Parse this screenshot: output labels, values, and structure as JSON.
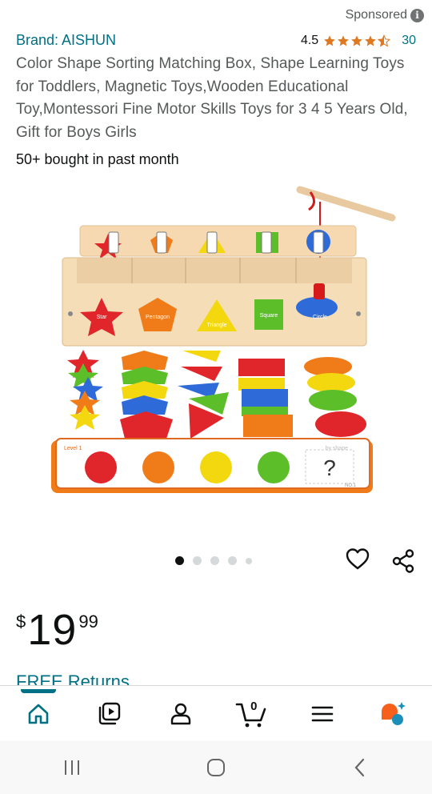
{
  "sponsored": {
    "label": "Sponsored",
    "icon": "info-icon"
  },
  "product": {
    "brand": "Brand: AISHUN",
    "rating": "4.5",
    "rating_stars": 4.5,
    "rating_count": "30",
    "title": "Color Shape Sorting Matching Box, Shape Learning Toys for Toddlers, Magnetic Toys,Wooden Educational Toy,Montessori Fine Motor Skills Toys for 3 4 5 Years Old, Gift for Boys Girls",
    "bought": "50+ bought in past month",
    "image_labels": {
      "star": "Star",
      "pentagon": "Pentagon",
      "triangle": "Triangle",
      "square": "Square",
      "circle": "Circle",
      "level": "Level 1",
      "by_shape": "by shape",
      "question": "?",
      "card_no": "NO.1"
    }
  },
  "carousel": {
    "count": 5,
    "active_index": 0
  },
  "price": {
    "symbol": "$",
    "whole": "19",
    "fraction": "99"
  },
  "shipping": {
    "label": "FREE Returns"
  },
  "nav": {
    "items": [
      "home-icon",
      "video-icon",
      "account-icon",
      "cart-icon",
      "menu-icon",
      "rufus-icon"
    ],
    "cart_count": "0",
    "active": "home"
  },
  "colors": {
    "link": "#007185",
    "star": "#de7921",
    "text": "#0f1111",
    "muted": "#565959"
  }
}
